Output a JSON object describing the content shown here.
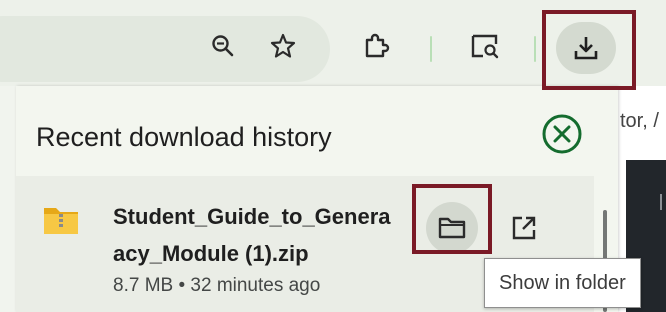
{
  "toolbar": {
    "icons": [
      "zoom-out-icon",
      "bookmark-star-icon",
      "extensions-puzzle-icon",
      "google-lens-search-icon",
      "download-icon"
    ]
  },
  "page": {
    "partial_text": "tor, /"
  },
  "download_panel": {
    "title": "Recent download history",
    "close_icon": "close-circle-icon",
    "items": [
      {
        "icon": "zip-folder-icon",
        "name_line1": "Student_Guide_to_Genera",
        "name_line2": "acy_Module (1).zip",
        "size": "8.7 MB",
        "time": "32 minutes ago",
        "meta": "8.7 MB • 32 minutes ago",
        "actions": [
          "show-in-folder",
          "open-external"
        ]
      }
    ]
  },
  "tooltip": {
    "text": "Show in folder"
  },
  "colors": {
    "highlight": "#7a1a26",
    "accent_green": "#146c2e",
    "separator_green": "#b9dfb6",
    "folder_yellow": "#f7c844"
  }
}
